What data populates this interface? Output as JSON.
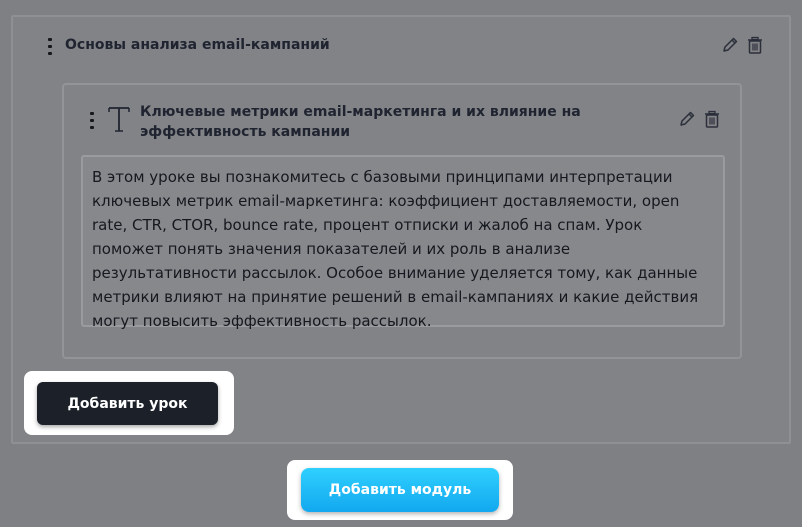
{
  "module": {
    "title": "Основы анализа email-кампаний",
    "icons": {
      "drag": "drag-handle-icon",
      "edit": "pencil-icon",
      "delete": "trash-icon"
    }
  },
  "lesson": {
    "title": "Ключевые метрики email-маркетинга и их влияние на эффективность кампании",
    "type_icon": "text-type-icon",
    "text": "В этом уроке вы познакомитесь с базовыми принципами интерпретации ключевых метрик email-маркетинга: коэффициент доставляемости, open rate, CTR, CTOR, bounce rate, процент отписки и жалоб на спам. Урок поможет понять значения показателей и их роль в анализе результативности рассылок. Особое внимание уделяется тому, как данные метрики влияют на принятие решений в email-кампаниях и какие действия могут повысить эффективность рассылок."
  },
  "buttons": {
    "add_lesson": "Добавить урок",
    "add_module": "Добавить модуль"
  },
  "colors": {
    "overlay": "#7f8084",
    "dark_button": "#1b2029",
    "accent_button": "#1cb8f5",
    "text": "#1f2430"
  }
}
